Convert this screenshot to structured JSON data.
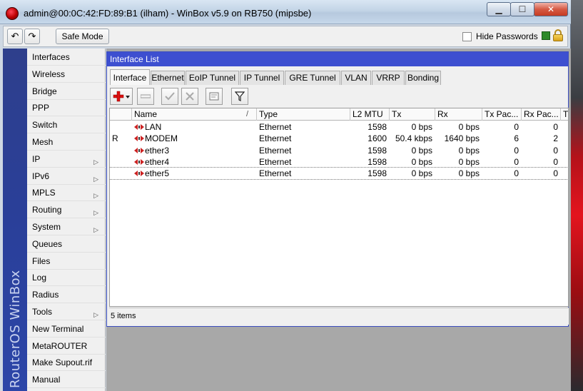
{
  "window": {
    "title": "admin@00:0C:42:FD:89:B1 (ilham) - WinBox v5.9 on RB750 (mipsbe)",
    "minimize_glyph": "▁",
    "maximize_glyph": "☐",
    "close_glyph": "✕"
  },
  "toolbar": {
    "undo_glyph": "↶",
    "redo_glyph": "↷",
    "safe_mode_label": "Safe Mode",
    "hide_passwords_label": "Hide Passwords",
    "hide_passwords_checked": false,
    "status_color": "#2e8a2a"
  },
  "brand": {
    "vertical_text": "RouterOS WinBox"
  },
  "sidebar": {
    "items": [
      {
        "label": "Interfaces",
        "submenu": false
      },
      {
        "label": "Wireless",
        "submenu": false
      },
      {
        "label": "Bridge",
        "submenu": false
      },
      {
        "label": "PPP",
        "submenu": false
      },
      {
        "label": "Switch",
        "submenu": false
      },
      {
        "label": "Mesh",
        "submenu": false
      },
      {
        "label": "IP",
        "submenu": true
      },
      {
        "label": "IPv6",
        "submenu": true
      },
      {
        "label": "MPLS",
        "submenu": true
      },
      {
        "label": "Routing",
        "submenu": true
      },
      {
        "label": "System",
        "submenu": true
      },
      {
        "label": "Queues",
        "submenu": false
      },
      {
        "label": "Files",
        "submenu": false
      },
      {
        "label": "Log",
        "submenu": false
      },
      {
        "label": "Radius",
        "submenu": false
      },
      {
        "label": "Tools",
        "submenu": true
      },
      {
        "label": "New Terminal",
        "submenu": false
      },
      {
        "label": "MetaROUTER",
        "submenu": false
      },
      {
        "label": "Make Supout.rif",
        "submenu": false
      },
      {
        "label": "Manual",
        "submenu": false
      }
    ]
  },
  "interface_list": {
    "title": "Interface List",
    "tabs": [
      "Interface",
      "Ethernet",
      "EoIP Tunnel",
      "IP Tunnel",
      "GRE Tunnel",
      "VLAN",
      "VRRP",
      "Bonding"
    ],
    "active_tab": "Interface",
    "columns": [
      "",
      "Name",
      "Type",
      "L2 MTU",
      "Tx",
      "Rx",
      "Tx Pac...",
      "Rx Pac...",
      "T"
    ],
    "sort_indicator": "/",
    "rows": [
      {
        "flag": "",
        "name": "LAN",
        "type": "Ethernet",
        "l2mtu": "1598",
        "tx": "0 bps",
        "rx": "0 bps",
        "tx_pkts": "0",
        "rx_pkts": "0"
      },
      {
        "flag": "R",
        "name": "MODEM",
        "type": "Ethernet",
        "l2mtu": "1600",
        "tx": "50.4 kbps",
        "rx": "1640 bps",
        "tx_pkts": "6",
        "rx_pkts": "2"
      },
      {
        "flag": "",
        "name": "ether3",
        "type": "Ethernet",
        "l2mtu": "1598",
        "tx": "0 bps",
        "rx": "0 bps",
        "tx_pkts": "0",
        "rx_pkts": "0"
      },
      {
        "flag": "",
        "name": "ether4",
        "type": "Ethernet",
        "l2mtu": "1598",
        "tx": "0 bps",
        "rx": "0 bps",
        "tx_pkts": "0",
        "rx_pkts": "0"
      },
      {
        "flag": "",
        "name": "ether5",
        "type": "Ethernet",
        "l2mtu": "1598",
        "tx": "0 bps",
        "rx": "0 bps",
        "tx_pkts": "0",
        "rx_pkts": "0"
      }
    ],
    "status": "5 items"
  }
}
